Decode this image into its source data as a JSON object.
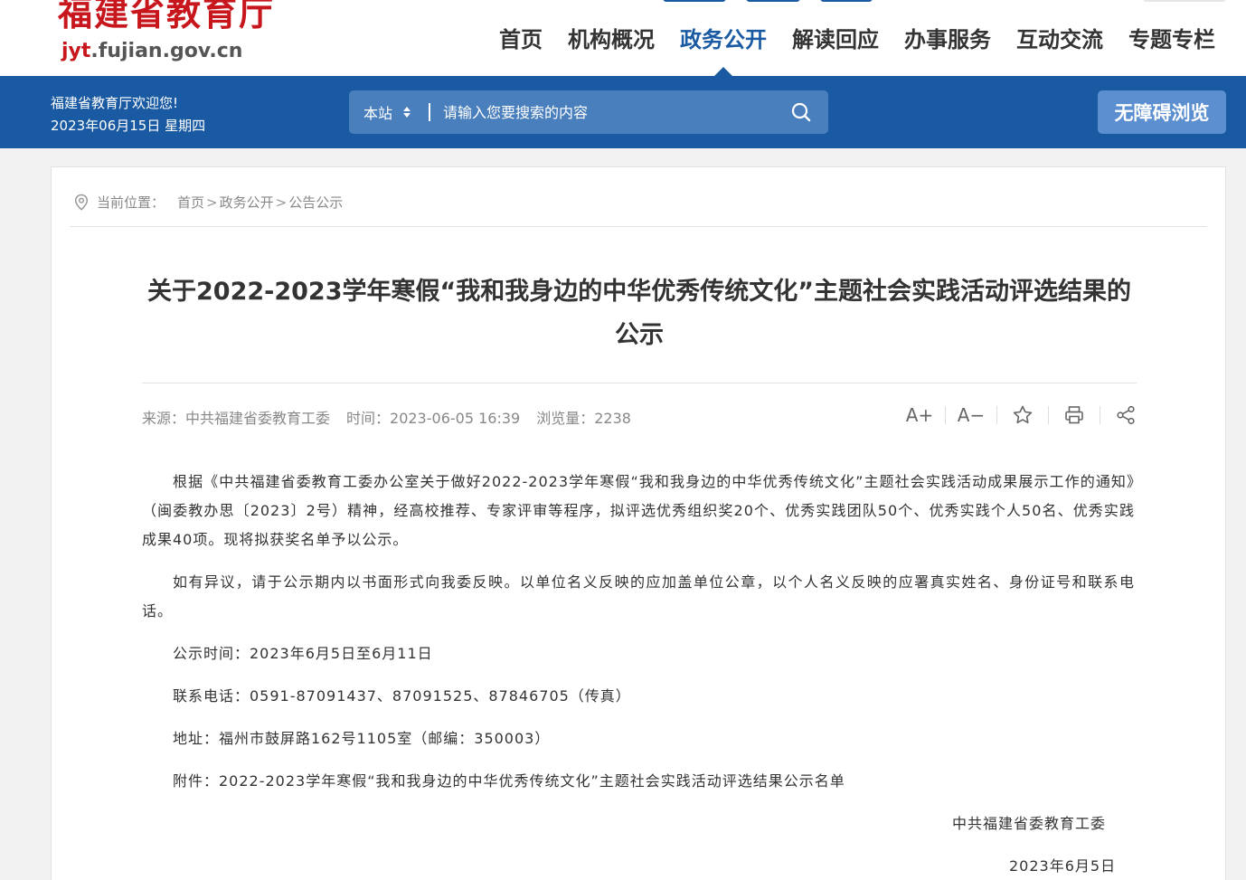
{
  "site": {
    "logo_name": "福建省教育厅",
    "logo_url_highlight": "jyt",
    "logo_url_rest": ".fujian.gov.cn"
  },
  "nav": {
    "items": [
      {
        "label": "首页"
      },
      {
        "label": "机构概况"
      },
      {
        "label": "政务公开",
        "active": true
      },
      {
        "label": "解读回应"
      },
      {
        "label": "办事服务"
      },
      {
        "label": "互动交流"
      },
      {
        "label": "专题专栏"
      }
    ]
  },
  "bar": {
    "welcome": "福建省教育厅欢迎您!",
    "date": "2023年06月15日 星期四",
    "search_scope": "本站",
    "search_placeholder": "请输入您要搜索的内容",
    "accessible_label": "无障碍浏览"
  },
  "breadcrumb": {
    "label": "当前位置：",
    "items": [
      "首页",
      "政务公开",
      "公告公示"
    ]
  },
  "article": {
    "title": "关于2022-2023学年寒假“我和我身边的中华优秀传统文化”主题社会实践活动评选结果的公示",
    "source": "来源：中共福建省委教育工委",
    "time": "时间：2023-06-05 16:39",
    "views": "浏览量：2238",
    "paragraphs": [
      "根据《中共福建省委教育工委办公室关于做好2022-2023学年寒假“我和我身边的中华优秀传统文化”主题社会实践活动成果展示工作的通知》（闽委教办思〔2023〕2号）精神，经高校推荐、专家评审等程序，拟评选优秀组织奖20个、优秀实践团队50个、优秀实践个人50名、优秀实践成果40项。现将拟获奖名单予以公示。",
      "如有异议，请于公示期内以书面形式向我委反映。以单位名义反映的应加盖单位公章，以个人名义反映的应署真实姓名、身份证号和联系电话。",
      "公示时间：2023年6月5日至6月11日",
      "联系电话：0591-87091437、87091525、87846705（传真）",
      "地址：福州市鼓屏路162号1105室（邮编：350003）",
      "附件：2022-2023学年寒假“我和我身边的中华优秀传统文化”主题社会实践活动评选结果公示名单"
    ],
    "signature": "中共福建省委教育工委",
    "sign_date": "2023年6月5日"
  },
  "tools": {
    "font_larger": "A+",
    "font_smaller": "A−"
  },
  "colors": {
    "brand_blue": "#1a5aa3",
    "logo_red": "#c8161d"
  }
}
